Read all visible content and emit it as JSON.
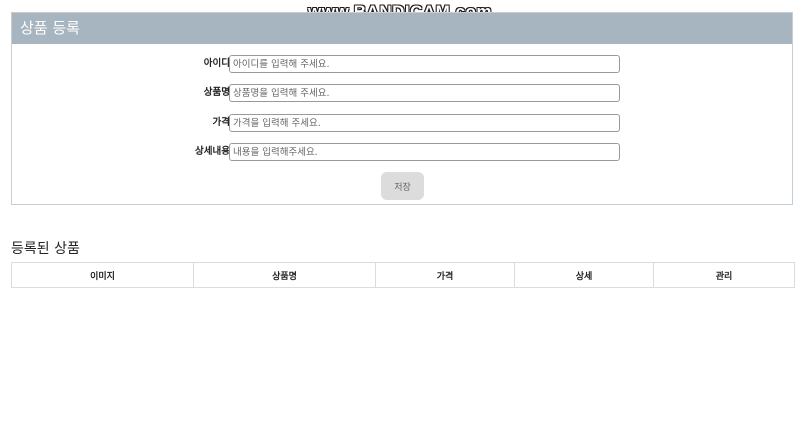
{
  "watermark": "www.BANDICAM.com",
  "register_panel": {
    "title": "상품 등록",
    "fields": [
      {
        "label": "아이디",
        "placeholder": "아이디를 입력해 주세요."
      },
      {
        "label": "상품명",
        "placeholder": "상품명을 입력해 주세요."
      },
      {
        "label": "가격",
        "placeholder": "가격을 입력해 주세요."
      },
      {
        "label": "상세내용",
        "placeholder": "내용을 입력해주세요."
      }
    ],
    "save_label": "저장"
  },
  "product_list": {
    "title": "등록된 상품",
    "columns": [
      "이미지",
      "상품명",
      "가격",
      "상세",
      "관리"
    ]
  }
}
